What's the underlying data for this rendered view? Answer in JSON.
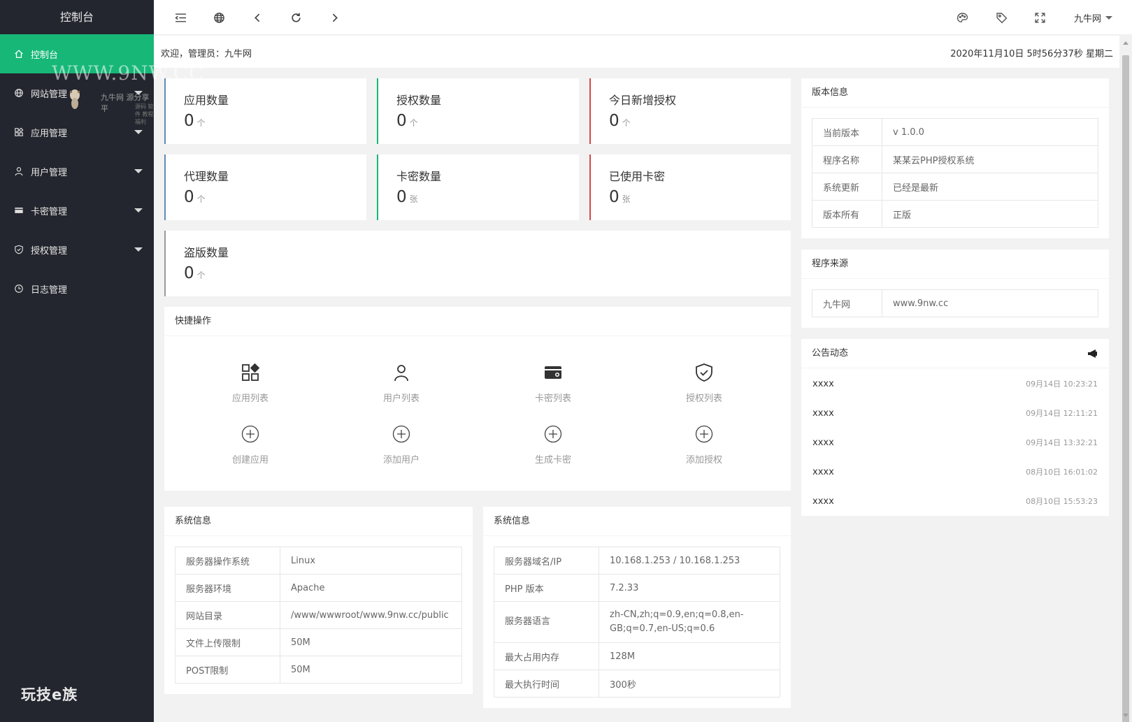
{
  "sidebar": {
    "title": "控制台",
    "items": [
      {
        "label": "控制台",
        "icon": "home-icon"
      },
      {
        "label": "网站管理",
        "icon": "globe-icon"
      },
      {
        "label": "应用管理",
        "icon": "apps-icon"
      },
      {
        "label": "用户管理",
        "icon": "user-icon"
      },
      {
        "label": "卡密管理",
        "icon": "card-icon"
      },
      {
        "label": "授权管理",
        "icon": "shield-icon"
      },
      {
        "label": "日志管理",
        "icon": "clock-icon"
      }
    ],
    "watermark": "WWW.9NW.CC",
    "watermark_sub": "九牛网  源分享平",
    "watermark_sub2": "源码 软件 教程 福利",
    "bottom_logo": "玩技e族"
  },
  "header": {
    "user": "九牛网"
  },
  "welcome": {
    "text": "欢迎，管理员：九牛网",
    "datetime": "2020年11月10日 5时56分37秒 星期二"
  },
  "stats": [
    {
      "title": "应用数量",
      "value": "0",
      "unit": "个",
      "color": "#5f8bb8"
    },
    {
      "title": "授权数量",
      "value": "0",
      "unit": "个",
      "color": "#16b777"
    },
    {
      "title": "今日新增授权",
      "value": "0",
      "unit": "个",
      "color": "#d4494a"
    },
    {
      "title": "代理数量",
      "value": "0",
      "unit": "个",
      "color": "#5f8bb8"
    },
    {
      "title": "卡密数量",
      "value": "0",
      "unit": "张",
      "color": "#16b777"
    },
    {
      "title": "已使用卡密",
      "value": "0",
      "unit": "张",
      "color": "#d4494a"
    },
    {
      "title": "盗版数量",
      "value": "0",
      "unit": "个",
      "color": "#9a9a9a"
    }
  ],
  "quick": {
    "title": "快捷操作",
    "items": [
      {
        "label": "应用列表",
        "icon": "apps-icon"
      },
      {
        "label": "用户列表",
        "icon": "user-icon"
      },
      {
        "label": "卡密列表",
        "icon": "wallet-icon"
      },
      {
        "label": "授权列表",
        "icon": "shield-check-icon"
      },
      {
        "label": "创建应用",
        "icon": "plus-circle-icon"
      },
      {
        "label": "添加用户",
        "icon": "plus-circle-icon"
      },
      {
        "label": "生成卡密",
        "icon": "plus-circle-icon"
      },
      {
        "label": "添加授权",
        "icon": "plus-circle-icon"
      }
    ]
  },
  "sys1": {
    "title": "系统信息",
    "rows": [
      {
        "k": "服务器操作系统",
        "v": "Linux"
      },
      {
        "k": "服务器环境",
        "v": "Apache"
      },
      {
        "k": "网站目录",
        "v": "/www/wwwroot/www.9nw.cc/public"
      },
      {
        "k": "文件上传限制",
        "v": "50M"
      },
      {
        "k": "POST限制",
        "v": "50M"
      }
    ]
  },
  "sys2": {
    "title": "系统信息",
    "rows": [
      {
        "k": "服务器域名/IP",
        "v": "10.168.1.253 / 10.168.1.253"
      },
      {
        "k": "PHP 版本",
        "v": "7.2.33"
      },
      {
        "k": "服务器语言",
        "v": "zh-CN,zh;q=0.9,en;q=0.8,en-GB;q=0.7,en-US;q=0.6"
      },
      {
        "k": "最大占用内存",
        "v": "128M"
      },
      {
        "k": "最大执行时间",
        "v": "300秒"
      }
    ]
  },
  "version": {
    "title": "版本信息",
    "rows": [
      {
        "k": "当前版本",
        "v": "v 1.0.0"
      },
      {
        "k": "程序名称",
        "v": "某某云PHP授权系统"
      },
      {
        "k": "系统更新",
        "v": "已经是最新"
      },
      {
        "k": "版本所有",
        "v": "正版"
      }
    ]
  },
  "source": {
    "title": "程序来源",
    "rows": [
      {
        "k": "九牛网",
        "v": "www.9nw.cc"
      }
    ]
  },
  "notices": {
    "title": "公告动态",
    "items": [
      {
        "title": "xxxx",
        "time": "09月14日 10:23:21"
      },
      {
        "title": "xxxx",
        "time": "09月14日 12:11:21"
      },
      {
        "title": "xxxx",
        "time": "09月14日 13:32:21"
      },
      {
        "title": "xxxx",
        "time": "08月10日 16:01:02"
      },
      {
        "title": "xxxx",
        "time": "08月10日 15:53:23"
      }
    ]
  },
  "colors": {
    "sidebar_bg": "#23262e",
    "accent": "#16b777"
  }
}
